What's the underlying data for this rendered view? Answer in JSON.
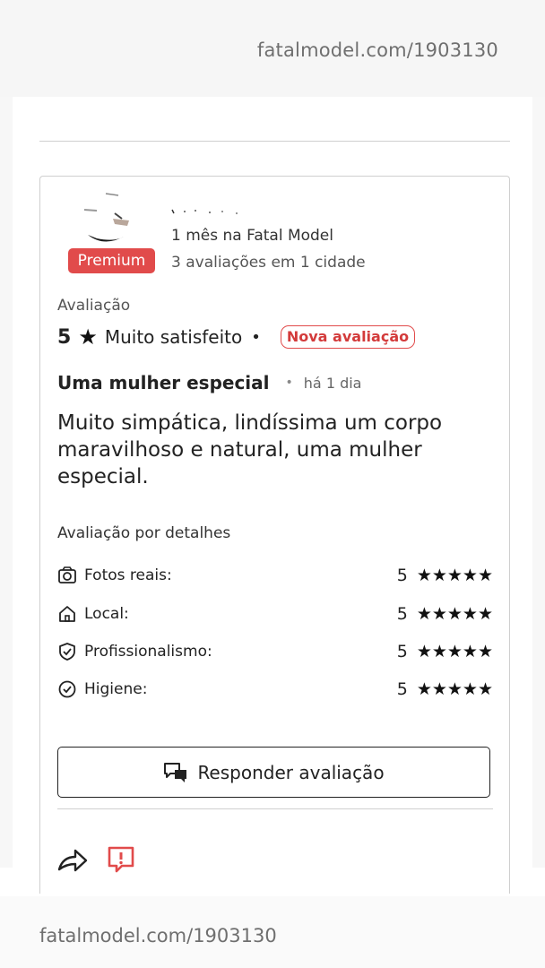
{
  "watermark": {
    "top": "fatalmodel.com/1903130",
    "bottom": "fatalmodel.com/1903130"
  },
  "reviewer": {
    "badge": "Premium",
    "member_since": "1 mês na Fatal Model",
    "reviews_count": "3 avaliações em 1 cidade"
  },
  "rating": {
    "label": "Avaliação",
    "score": "5",
    "star": "★",
    "text": "Muito satisfeito",
    "separator": "•",
    "new_badge": "Nova avaliação"
  },
  "review": {
    "title": "Uma mulher especial",
    "separator": "•",
    "time": "há 1 dia",
    "body": "Muito simpática, lindíssima um corpo maravilhoso e natural, uma mulher especial."
  },
  "details": {
    "heading": "Avaliação por detalhes",
    "items": [
      {
        "label": "Fotos reais:",
        "score": "5",
        "stars": "★★★★★",
        "icon": "camera-icon"
      },
      {
        "label": "Local:",
        "score": "5",
        "stars": "★★★★★",
        "icon": "home-icon"
      },
      {
        "label": "Profissionalismo:",
        "score": "5",
        "stars": "★★★★★",
        "icon": "shield-check-icon"
      },
      {
        "label": "Higiene:",
        "score": "5",
        "stars": "★★★★★",
        "icon": "check-circle-icon"
      }
    ]
  },
  "actions": {
    "reply_label": "Responder avaliação",
    "share_icon": "share-icon",
    "report_icon": "report-icon"
  },
  "colors": {
    "accent": "#e14b4b",
    "text": "#222222",
    "border": "#cfcfcf"
  }
}
